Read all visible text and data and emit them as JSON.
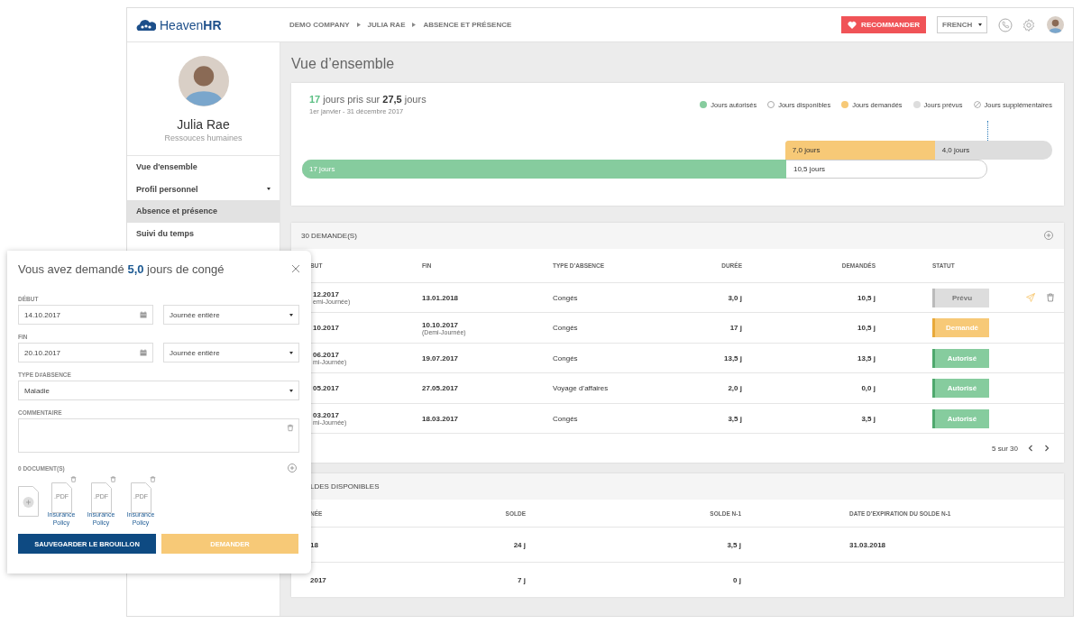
{
  "header": {
    "logo": "Heaven**HR**",
    "breadcrumb": [
      "DEMO COMPANY",
      "JULIA RAE",
      "ABSENCE ET PRÉSENCE"
    ],
    "recommend_button": "RECOMMANDER",
    "language": "FRENCH"
  },
  "profile": {
    "name": "Julia Rae",
    "role": "Ressouces humaines"
  },
  "sidebar": {
    "items": [
      {
        "label": "Vue d'ensemble",
        "kind": "link",
        "selected": false
      },
      {
        "label": "Profil personnel",
        "kind": "dropdown",
        "selected": false
      },
      {
        "label": "Absence et présence",
        "kind": "link",
        "selected": true
      },
      {
        "label": "Suivi du temps",
        "kind": "link",
        "selected": false
      }
    ]
  },
  "overview": {
    "title": "Vue d’ensemble",
    "taken": "17",
    "taken_text": "jours pris sur",
    "total": "27,5",
    "total_unit": "jours",
    "period": "1er janvier - 31 décembre 2017",
    "legend": [
      {
        "label": "Jours autorisés",
        "kind": "dot",
        "color": "#86cc9e"
      },
      {
        "label": "Jours disponibles",
        "kind": "ring",
        "color": "#ffffff"
      },
      {
        "label": "Jours demandés",
        "kind": "dot",
        "color": "#f7c977"
      },
      {
        "label": "Jours prévus",
        "kind": "dot",
        "color": "#dddddd"
      },
      {
        "label": "Jours supplémentaires",
        "kind": "striped",
        "color": "#ffffff"
      }
    ],
    "upper_bar": {
      "fill_label": "7,0 jours",
      "label": "4,0 jours",
      "level": 0.56
    },
    "lower_bar": {
      "fill_label": "17 jours",
      "label": "10,5 jours",
      "level": 0.708
    }
  },
  "requests": {
    "title": "30 DEMANDE(S)",
    "columns": [
      "BUT",
      "FIN",
      "TYPE D’ABSENCE",
      "DURÉE",
      "DEMANDÉS",
      "STATUT"
    ],
    "rows": [
      {
        "start": "12.2017",
        "start_note": "emi-Journée)",
        "end": "13.01.2018",
        "type": "Congés",
        "duration": "3,0 j",
        "requested": "10,5 j",
        "status": {
          "label": "Prévu",
          "kind": "planned"
        },
        "has_actions": true
      },
      {
        "start": "10.2017",
        "end": "10.10.2017",
        "end_note": "(Demi-Journée)",
        "type": "Congés",
        "duration": "17 j",
        "requested": "10,5 j",
        "status": {
          "label": "Demandé",
          "kind": "requested"
        },
        "has_actions": false
      },
      {
        "start": "06.2017",
        "start_note": "mi-Journée)",
        "end": "19.07.2017",
        "type": "Congés",
        "duration": "13,5 j",
        "requested": "13,5 j",
        "status": {
          "label": "Autorisé",
          "kind": "approved"
        },
        "has_actions": false
      },
      {
        "start": "05.2017",
        "end": "27.05.2017",
        "type": "Voyage d’affaires",
        "duration": "2,0 j",
        "requested": "0,0 j",
        "status": {
          "label": "Autorisé",
          "kind": "approved"
        },
        "has_actions": false
      },
      {
        "start": "03.2017",
        "start_note": "mi-Journée)",
        "end": "18.03.2017",
        "type": "Congés",
        "duration": "3,5 j",
        "requested": "3,5 j",
        "status": {
          "label": "Autorisé",
          "kind": "approved"
        },
        "has_actions": false
      }
    ],
    "pagination": "5 sur 30"
  },
  "balances": {
    "title": "LDES DISPONIBLES",
    "columns": [
      "NÉE",
      "SOLDE",
      "SOLDE N-1",
      "DATE D’EXPIRATION DU SOLDE N-1"
    ],
    "rows": [
      [
        "18",
        "24 j",
        "3,5 j",
        "31.03.2018"
      ],
      [
        "2017",
        "7 j",
        "0 j"
      ]
    ]
  },
  "modal": {
    "title_before": "Vous avez demandé",
    "days": "5,0",
    "title_after": "jours de congé",
    "start_label": "DÉBUT",
    "start_date": "14.10.2017",
    "start_period": "Journée entière",
    "end_label": "FIN",
    "end_date": "20.10.2017",
    "end_period": "Journée entière",
    "type_label": "TYPE D#ABSENCE",
    "type": "Maladie",
    "comment_label": "COMMENTAIRE",
    "documents_label": "0 DOCUMENT(S)",
    "documents": [
      {
        "ext": ".PDF",
        "name": "Insurance Policy"
      },
      {
        "ext": ".PDF",
        "name": "Insurance Policy"
      },
      {
        "ext": ".PDF",
        "name": "Insurance Policy"
      }
    ],
    "buttons": [
      {
        "label": "SAUVEGARDER LE BROUILLON",
        "kind": "primary"
      },
      {
        "label": "DEMANDER",
        "kind": "secondary"
      }
    ]
  }
}
